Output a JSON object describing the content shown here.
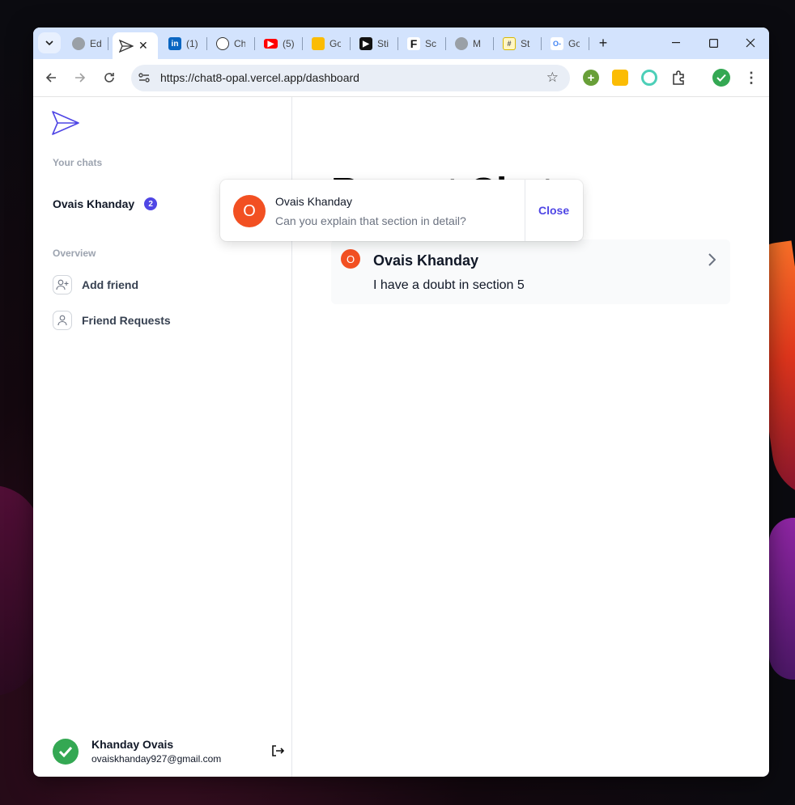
{
  "browser": {
    "tabs": [
      {
        "label": "Ed",
        "icon": "github-icon"
      },
      {
        "label": "",
        "icon": "paper-plane-icon",
        "active": true
      },
      {
        "label": "(1)",
        "icon": "linkedin-icon"
      },
      {
        "label": "Ch",
        "icon": "chatgpt-icon"
      },
      {
        "label": "(5)",
        "icon": "youtube-icon"
      },
      {
        "label": "Go",
        "icon": "google-keep-icon"
      },
      {
        "label": "Sti",
        "icon": "play-icon"
      },
      {
        "label": "Sc",
        "icon": "framer-icon"
      },
      {
        "label": "M",
        "icon": "github-icon"
      },
      {
        "label": "St",
        "icon": "hash-icon"
      },
      {
        "label": "Go",
        "icon": "google-key-icon"
      }
    ],
    "url": "https://chat8-opal.vercel.app/dashboard"
  },
  "sidebar": {
    "your_chats_label": "Your chats",
    "chats": [
      {
        "name": "Ovais Khanday",
        "unread": "2"
      }
    ],
    "overview_label": "Overview",
    "nav": [
      {
        "label": "Add friend",
        "icon": "user-plus-icon"
      },
      {
        "label": "Friend Requests",
        "icon": "user-icon"
      }
    ],
    "profile": {
      "name": "Khanday Ovais",
      "email": "ovaiskhanday927@gmail.com"
    }
  },
  "main": {
    "title": "Recent Chats",
    "recent": [
      {
        "initial": "O",
        "name": "Ovais Khanday",
        "message": "I have a doubt in section 5"
      }
    ]
  },
  "toast": {
    "initial": "O",
    "name": "Ovais Khanday",
    "message": "Can you explain that section in detail?",
    "close_label": "Close"
  },
  "colors": {
    "accent": "#4f46e5",
    "avatar": "#f25022",
    "profile": "#34a853",
    "tabstrip": "#d3e3fd"
  }
}
